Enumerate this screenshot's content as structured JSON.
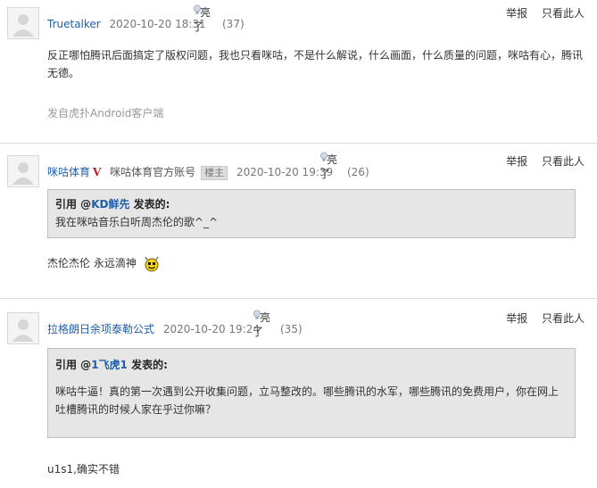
{
  "posts": [
    {
      "username": "Truetalker",
      "verified_mark": "",
      "account_label": "",
      "badge": "",
      "time": "2020-10-20 18:31",
      "light_label_1": "亮",
      "light_label_2": "了",
      "light_count": "(37)",
      "report": "举报",
      "only_author": "只看此人",
      "body": "反正哪怕腾讯后面搞定了版权问题，我也只看咪咕，不是什么解说，什么画面，什么质量的问题，咪咕有心，腾讯无德。",
      "source": "发自虎扑Android客户端"
    },
    {
      "username": "咪咕体育",
      "verified_mark": "V",
      "account_label": "咪咕体育官方账号",
      "badge": "楼主",
      "time": "2020-10-20 19:39",
      "light_label_1": "亮",
      "light_label_2": "了",
      "light_count": "(26)",
      "report": "举报",
      "only_author": "只看此人",
      "quote_prefix": "引用 @",
      "quote_user": "KD鲜先",
      "quote_suffix": " 发表的:",
      "quote_text": "我在咪咕音乐白听周杰伦的歌^_^",
      "reply": "杰伦杰伦 永远滴神",
      "emoji": "smiley-emoji"
    },
    {
      "username": "拉格朗日余项泰勒公式",
      "time": "2020-10-20 19:24",
      "light_label_1": "亮",
      "light_label_2": "了",
      "light_count": "(35)",
      "report": "举报",
      "only_author": "只看此人",
      "quote_prefix": "引用 @",
      "quote_user": "1飞虎1",
      "quote_suffix": " 发表的:",
      "quote_text": "咪咕牛逼！真的第一次遇到公开收集问题，立马整改的。哪些腾讯的水军，哪些腾讯的免费用户，你在网上吐槽腾讯的时候人家在乎过你嘛？",
      "reply": "u1s1,确实不错"
    }
  ],
  "colors": {
    "username": "#1f5fa8",
    "verified": "#b52020",
    "quote_bg": "#e6e6e6"
  }
}
